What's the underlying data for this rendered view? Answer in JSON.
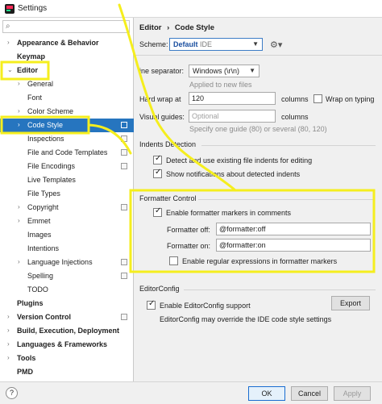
{
  "window": {
    "title": "Settings"
  },
  "sidebar": {
    "search_placeholder": "",
    "items": [
      {
        "label": "Appearance & Behavior",
        "arrow": "›",
        "level": 0,
        "bold": true
      },
      {
        "label": "Keymap",
        "arrow": "",
        "level": 0,
        "bold": true
      },
      {
        "label": "Editor",
        "arrow": "⌄",
        "level": 0,
        "bold": true
      },
      {
        "label": "General",
        "arrow": "›",
        "level": 1
      },
      {
        "label": "Font",
        "arrow": "",
        "level": 1
      },
      {
        "label": "Color Scheme",
        "arrow": "›",
        "level": 1
      },
      {
        "label": "Code Style",
        "arrow": "›",
        "level": 1,
        "selected": true,
        "project": true
      },
      {
        "label": "Inspections",
        "arrow": "",
        "level": 1,
        "project": true
      },
      {
        "label": "File and Code Templates",
        "arrow": "",
        "level": 1,
        "project": true
      },
      {
        "label": "File Encodings",
        "arrow": "",
        "level": 1,
        "project": true
      },
      {
        "label": "Live Templates",
        "arrow": "",
        "level": 1
      },
      {
        "label": "File Types",
        "arrow": "",
        "level": 1
      },
      {
        "label": "Copyright",
        "arrow": "›",
        "level": 1,
        "project": true
      },
      {
        "label": "Emmet",
        "arrow": "›",
        "level": 1
      },
      {
        "label": "Images",
        "arrow": "",
        "level": 1
      },
      {
        "label": "Intentions",
        "arrow": "",
        "level": 1
      },
      {
        "label": "Language Injections",
        "arrow": "›",
        "level": 1,
        "project": true
      },
      {
        "label": "Spelling",
        "arrow": "",
        "level": 1,
        "project": true
      },
      {
        "label": "TODO",
        "arrow": "",
        "level": 1
      },
      {
        "label": "Plugins",
        "arrow": "",
        "level": 0,
        "bold": true
      },
      {
        "label": "Version Control",
        "arrow": "›",
        "level": 0,
        "bold": true,
        "project": true
      },
      {
        "label": "Build, Execution, Deployment",
        "arrow": "›",
        "level": 0,
        "bold": true
      },
      {
        "label": "Languages & Frameworks",
        "arrow": "›",
        "level": 0,
        "bold": true
      },
      {
        "label": "Tools",
        "arrow": "›",
        "level": 0,
        "bold": true
      },
      {
        "label": "PMD",
        "arrow": "",
        "level": 0,
        "bold": true
      }
    ]
  },
  "content": {
    "breadcrumb": {
      "part1": "Editor",
      "sep": "›",
      "part2": "Code Style"
    },
    "scheme": {
      "label": "Scheme:",
      "value_bold": "Default",
      "value_suffix": "IDE"
    },
    "line_separator": {
      "label": "ine separator:",
      "value": "Windows (\\r\\n)",
      "hint": "Applied to new files"
    },
    "hard_wrap": {
      "label": "Hard wrap at",
      "value": "120",
      "unit": "columns",
      "wrap_label": "Wrap on typing"
    },
    "visual_guides": {
      "label": "Visual guides:",
      "placeholder": "Optional",
      "unit": "columns",
      "hint": "Specify one guide (80) or several (80, 120)"
    },
    "indents": {
      "title": "Indents Detection",
      "detect_label": "Detect and use existing file indents for editing",
      "notify_label": "Show notifications about detected indents"
    },
    "formatter": {
      "title": "Formatter Control",
      "enable_label": "Enable formatter markers in comments",
      "off_label": "Formatter off:",
      "off_value": "@formatter:off",
      "on_label": "Formatter on:",
      "on_value": "@formatter:on",
      "regex_label": "Enable regular expressions in formatter markers"
    },
    "editorconfig": {
      "title": "EditorConfig",
      "enable_label": "Enable EditorConfig support",
      "export_label": "Export",
      "note": "EditorConfig may override the IDE code style settings"
    }
  },
  "footer": {
    "help": "?",
    "ok": "OK",
    "cancel": "Cancel",
    "apply": "Apply"
  },
  "colors": {
    "highlight": "#f5ee1e",
    "selection": "#2675bf"
  }
}
